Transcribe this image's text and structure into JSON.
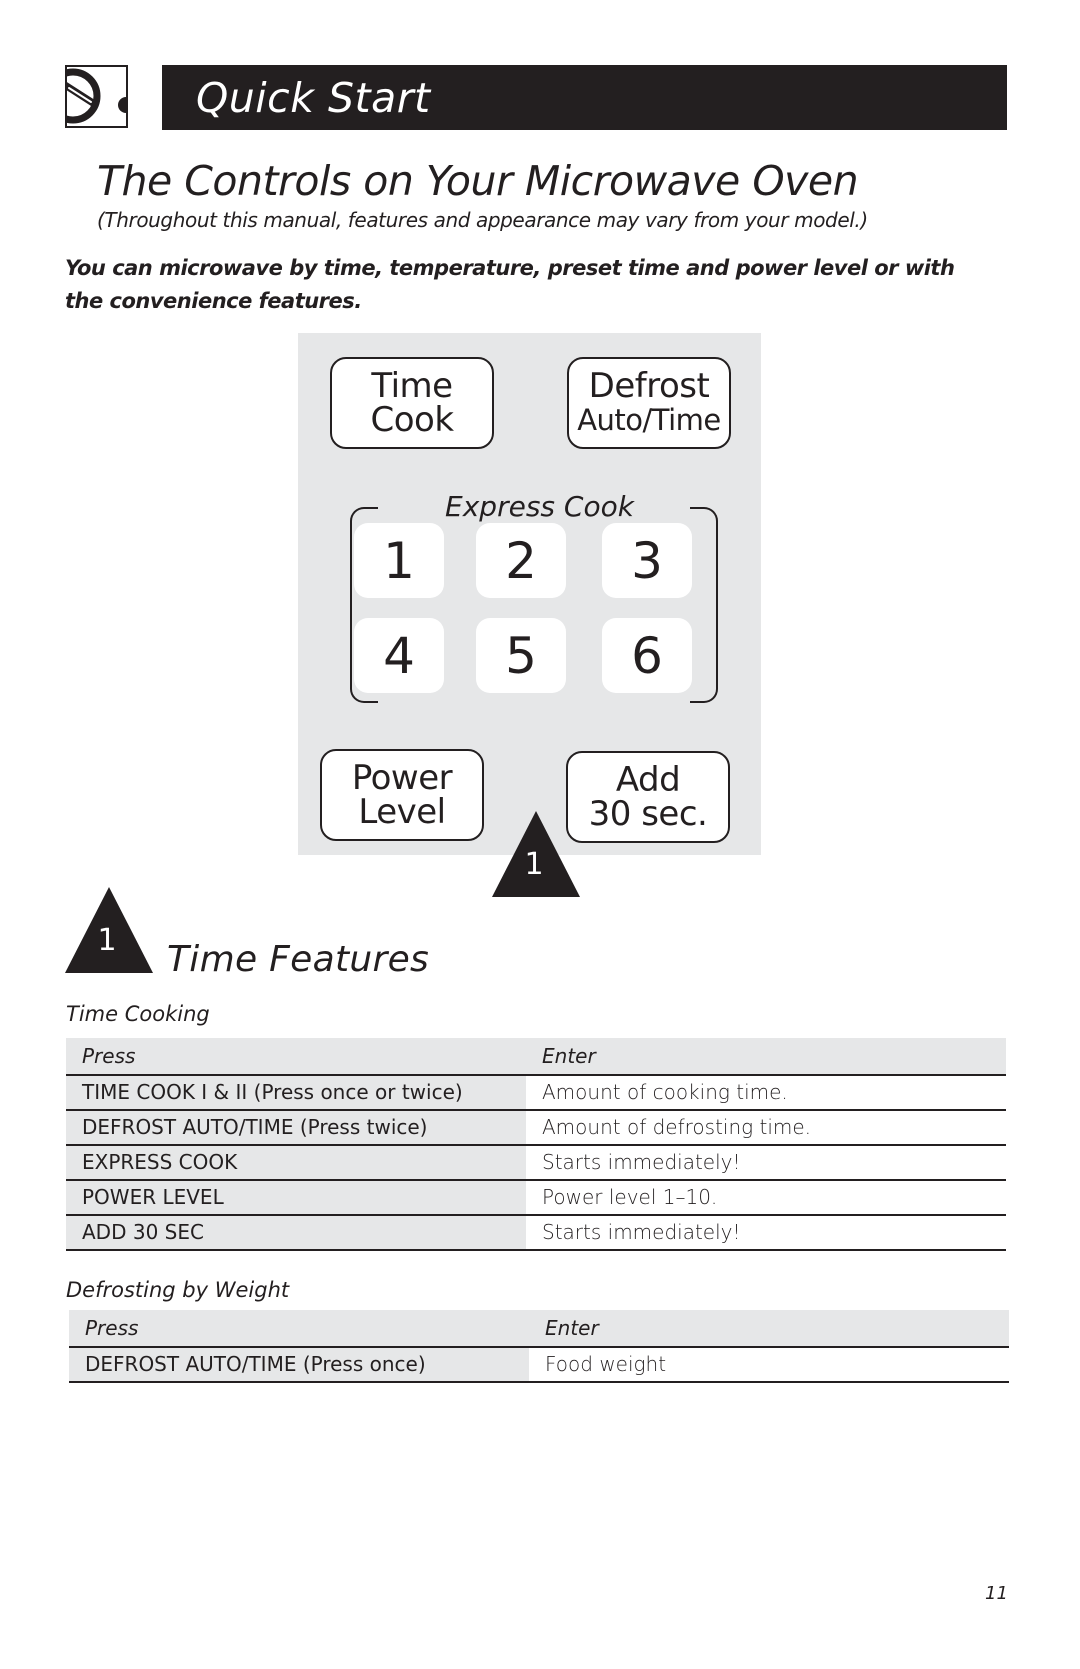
{
  "header": {
    "logo_icon": "microwave-dial-icon",
    "title": "Quick Start"
  },
  "page": {
    "title": "The Controls on Your Microwave Oven",
    "subtitle": "(Throughout this manual, features and appearance may vary from your model.)",
    "intro": "You can microwave by time, temperature, preset time and power level or with the convenience features."
  },
  "panel": {
    "time_cook": {
      "line1": "Time",
      "line2": "Cook"
    },
    "defrost": {
      "line1": "Defrost",
      "line2": "Auto/Time"
    },
    "express_cook_label": "Express Cook",
    "keys": [
      "1",
      "2",
      "3",
      "4",
      "5",
      "6"
    ],
    "power_level": {
      "line1": "Power",
      "line2": "Level"
    },
    "add_30": {
      "line1": "Add",
      "line2": "30 sec."
    },
    "callout_marker": "1"
  },
  "section": {
    "marker": "1",
    "title": "Time Features"
  },
  "time_cooking": {
    "label": "Time Cooking",
    "columns": [
      "Press",
      "Enter"
    ],
    "rows": [
      [
        "TIME COOK I & II (Press once or twice)",
        "Amount of cooking time."
      ],
      [
        "DEFROST AUTO/TIME (Press twice)",
        "Amount of defrosting time."
      ],
      [
        "EXPRESS COOK",
        "Starts immediately!"
      ],
      [
        "POWER LEVEL",
        "Power level 1–10."
      ],
      [
        "ADD 30 SEC",
        "Starts immediately!"
      ]
    ]
  },
  "defrost_weight": {
    "label": "Defrosting by Weight",
    "columns": [
      "Press",
      "Enter"
    ],
    "rows": [
      [
        "DEFROST AUTO/TIME (Press once)",
        "Food weight"
      ]
    ]
  },
  "footer": {
    "page_number": "11"
  }
}
